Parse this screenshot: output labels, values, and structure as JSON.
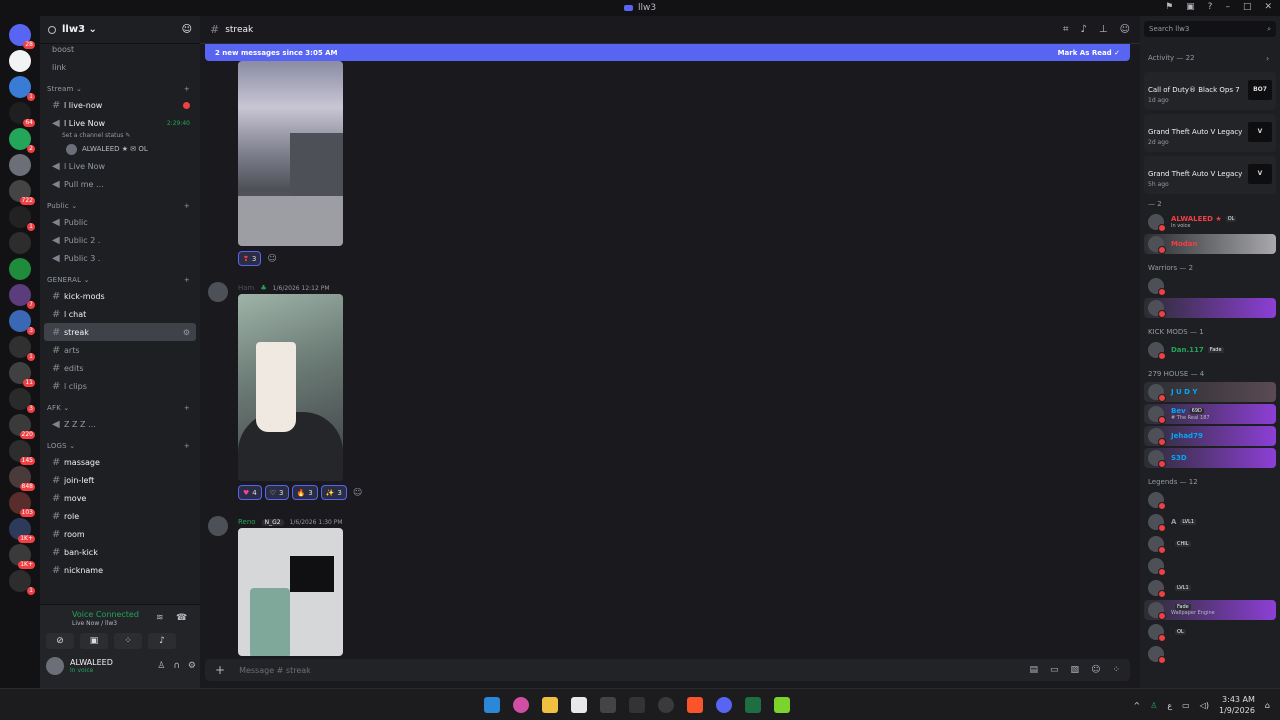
{
  "titlebar": {
    "title": "llw3"
  },
  "servers": [
    {
      "color": "#5865f2",
      "badge": "28"
    },
    {
      "color": "#f2f3f5",
      "badge": ""
    },
    {
      "color": "#3a7bd5",
      "badge": "1"
    },
    {
      "color": "#1f1f22",
      "badge": "64"
    },
    {
      "color": "#23a55a",
      "badge": "2"
    },
    {
      "color": "#6d6f78",
      "badge": ""
    },
    {
      "color": "#444",
      "badge": "722"
    },
    {
      "color": "#222",
      "badge": "1"
    },
    {
      "color": "#2d2d2d",
      "badge": ""
    },
    {
      "color": "#1f8b3d",
      "badge": ""
    },
    {
      "color": "#5a3d7a",
      "badge": "7"
    },
    {
      "color": "#3a68b5",
      "badge": "3"
    },
    {
      "color": "#303030",
      "badge": "1"
    },
    {
      "color": "#404040",
      "badge": "11"
    },
    {
      "color": "#2a2a2a",
      "badge": "3"
    },
    {
      "color": "#3a3a3a",
      "badge": "220"
    },
    {
      "color": "#2d2d2d",
      "badge": "145"
    },
    {
      "color": "#4a3a3a",
      "badge": "848"
    },
    {
      "color": "#5a2d2d",
      "badge": "103"
    },
    {
      "color": "#2d3a5a",
      "badge": "1K+"
    },
    {
      "color": "#3a3a3a",
      "badge": "1K+"
    },
    {
      "color": "#2d2d2d",
      "badge": "1"
    }
  ],
  "guild": {
    "name": "llw3 ⌄"
  },
  "channels": {
    "top": [
      {
        "label": "boost"
      },
      {
        "label": "link"
      }
    ],
    "stream_cat": "Stream ⌄",
    "live_now": "l live-now",
    "voice_live": "l Live Now",
    "voice_timer": "2:29:40",
    "set_status": "Set a channel status ✎",
    "voice_user": "ALWALEED ★ ✉ OL",
    "live_now2": "l Live Now",
    "pull_me": "Pull me ...",
    "public_cat": "Public ⌄",
    "public": [
      {
        "label": "Public"
      },
      {
        "label": "Public 2 ."
      },
      {
        "label": "Public 3 ."
      }
    ],
    "general_cat": "GENERAL ⌄",
    "general": [
      {
        "label": "kick-mods"
      },
      {
        "label": "l chat"
      }
    ],
    "streak": "streak",
    "general2": [
      {
        "label": "arts"
      },
      {
        "label": "edits"
      },
      {
        "label": "l clips"
      }
    ],
    "afk_cat": "AFK ⌄",
    "afk": "Z Z Z ...",
    "logs_cat": "LOGS ⌄",
    "logs": [
      {
        "label": "massage"
      },
      {
        "label": "join-left"
      },
      {
        "label": "move"
      },
      {
        "label": "role"
      },
      {
        "label": "room"
      },
      {
        "label": "ban-kick"
      },
      {
        "label": "nickname"
      }
    ]
  },
  "voice_panel": {
    "title": "Voice Connected",
    "sub": "Live Now / llw3"
  },
  "user": {
    "name": "ALWALEED",
    "status": "In voice"
  },
  "chat": {
    "channel": "streak",
    "new_messages": "2 new messages since 3:05 AM",
    "mark_as_read": "Mark As Read ✓",
    "composer_placeholder": "Message # streak"
  },
  "messages": [
    {
      "reactions": [
        {
          "emoji": "❣",
          "count": "3"
        }
      ]
    },
    {
      "author": "Ham",
      "time": "1/6/2026 12:12 PM",
      "reactions": [
        {
          "emoji": "♥",
          "count": "4"
        },
        {
          "emoji": "♡",
          "count": "3"
        },
        {
          "emoji": "🔥",
          "count": "3"
        },
        {
          "emoji": "✨",
          "count": "3"
        }
      ]
    },
    {
      "author": "Reno",
      "tag": "N_G2",
      "time": "1/6/2026 1:30 PM"
    }
  ],
  "members": {
    "search_placeholder": "Search llw3",
    "activity_title": "Activity — 22",
    "activities": [
      {
        "game": "Call of Duty® Black Ops 7",
        "when": "1d ago",
        "logo": "BO7"
      },
      {
        "game": "Grand Theft Auto V Legacy",
        "when": "2d ago",
        "logo": "V"
      },
      {
        "game": "Grand Theft Auto V Legacy",
        "when": "5h ago",
        "logo": "V"
      }
    ],
    "group1": "— 2",
    "g1": [
      {
        "name": "ALWALEED ★",
        "tag": "OL",
        "sub": "In voice",
        "color": "#f23f43"
      },
      {
        "name": "Modan",
        "color": "#f23f43"
      }
    ],
    "group2": "Warriors — 2",
    "g2": [
      {
        "name": "",
        "color": "#5865f2"
      },
      {
        "name": "",
        "color": "#5865f2"
      }
    ],
    "group3": "KICK MODS — 1",
    "g3": [
      {
        "name": "Dan.117",
        "tag": "Fade",
        "color": "#23a55a"
      }
    ],
    "group4": "279 HOUSE — 4",
    "g4": [
      {
        "name": "J U D Y",
        "color": "#00a8fc"
      },
      {
        "name": "Bev",
        "tag": "69D",
        "sub": "# The Real 187",
        "color": "#00a8fc"
      },
      {
        "name": "Jehad79",
        "color": "#00a8fc"
      },
      {
        "name": "S3D",
        "color": "#00a8fc"
      }
    ],
    "group5": "Legends — 12",
    "g5": [
      {
        "name": "",
        "color": "#949ba4"
      },
      {
        "name": "A",
        "tag": "LVL1",
        "color": "#949ba4"
      },
      {
        "name": "",
        "tag": "CHIL",
        "color": "#949ba4"
      },
      {
        "name": "",
        "color": "#949ba4"
      },
      {
        "name": "",
        "tag": "LVL1",
        "color": "#949ba4"
      },
      {
        "name": "",
        "tag": "Fade",
        "sub": "Wallpaper Engine",
        "color": "#949ba4"
      },
      {
        "name": "",
        "tag": "OL",
        "color": "#949ba4"
      },
      {
        "name": "",
        "color": "#949ba4"
      }
    ]
  },
  "taskbar": {
    "time": "3:43 AM",
    "date": "1/9/2026",
    "lang": "ع"
  }
}
